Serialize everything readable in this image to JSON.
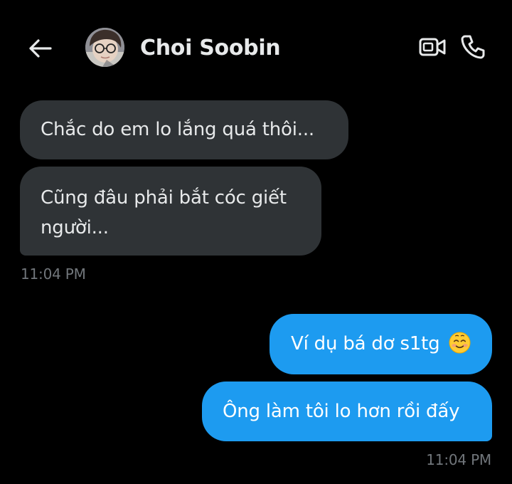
{
  "header": {
    "back_icon": "arrow-left-icon",
    "contact_name": "Choi Soobin",
    "video_icon": "video-camera-icon",
    "call_icon": "phone-icon"
  },
  "messages": [
    {
      "direction": "incoming",
      "text": "Chắc do em lo lắng quá thôi..."
    },
    {
      "direction": "incoming",
      "text": "Cũng đâu phải bắt cóc giết người..."
    },
    {
      "direction": "outgoing",
      "text": "Ví dụ bá dơ s1tg",
      "emoji": "smiling-face-with-blush"
    },
    {
      "direction": "outgoing",
      "text": "Ông làm tôi lo hơn rồi đấy"
    }
  ],
  "timestamps": {
    "incoming": "11:04 PM",
    "outgoing": "11:04 PM"
  },
  "colors": {
    "background": "#000000",
    "incoming_bubble": "#2f3336",
    "outgoing_bubble": "#1d9bf0",
    "primary_text": "#e7e9ea",
    "secondary_text": "#71767b"
  }
}
